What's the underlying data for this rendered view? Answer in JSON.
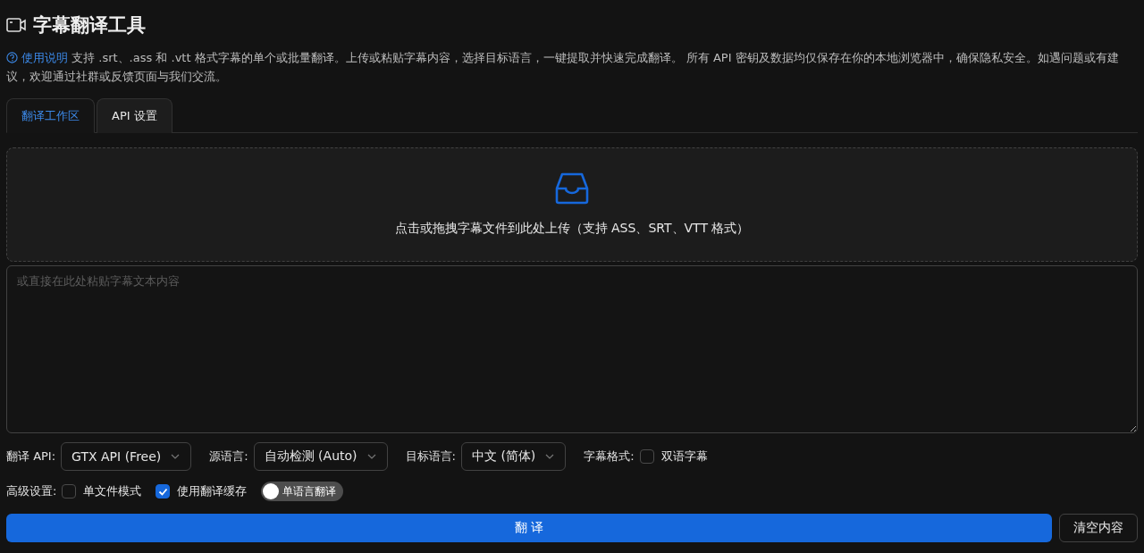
{
  "title": "字幕翻译工具",
  "intro": {
    "link": "使用说明",
    "text": "支持 .srt、.ass 和 .vtt 格式字幕的单个或批量翻译。上传或粘贴字幕内容，选择目标语言，一键提取并快速完成翻译。 所有 API 密钥及数据均仅保存在你的本地浏览器中，确保隐私安全。如遇问题或有建议，欢迎通过社群或反馈页面与我们交流。"
  },
  "tabs": [
    {
      "label": "翻译工作区",
      "selected": true
    },
    {
      "label": "API 设置",
      "selected": false
    }
  ],
  "upload": {
    "text": "点击或拖拽字幕文件到此处上传（支持 ASS、SRT、VTT 格式）"
  },
  "textarea": {
    "placeholder": "或直接在此处粘贴字幕文本内容"
  },
  "options": [
    {
      "kind": "select",
      "label": "翻译 API:",
      "value": "GTX API (Free)"
    },
    {
      "kind": "select",
      "label": "源语言:",
      "value": "自动检测 (Auto)"
    },
    {
      "kind": "select",
      "label": "目标语言:",
      "value": "中文 (简体)"
    },
    {
      "kind": "checkbox",
      "label": "字幕格式:",
      "option": "双语字幕",
      "checked": false
    }
  ],
  "advanced": {
    "label": "高级设置:",
    "items": [
      {
        "kind": "checkbox",
        "label": "单文件模式",
        "checked": false
      },
      {
        "kind": "checkbox",
        "label": "使用翻译缓存",
        "checked": true
      },
      {
        "kind": "switch",
        "label": "单语言翻译",
        "on": false
      }
    ]
  },
  "buttons": {
    "translate": "翻 译",
    "clear": "清空内容"
  }
}
